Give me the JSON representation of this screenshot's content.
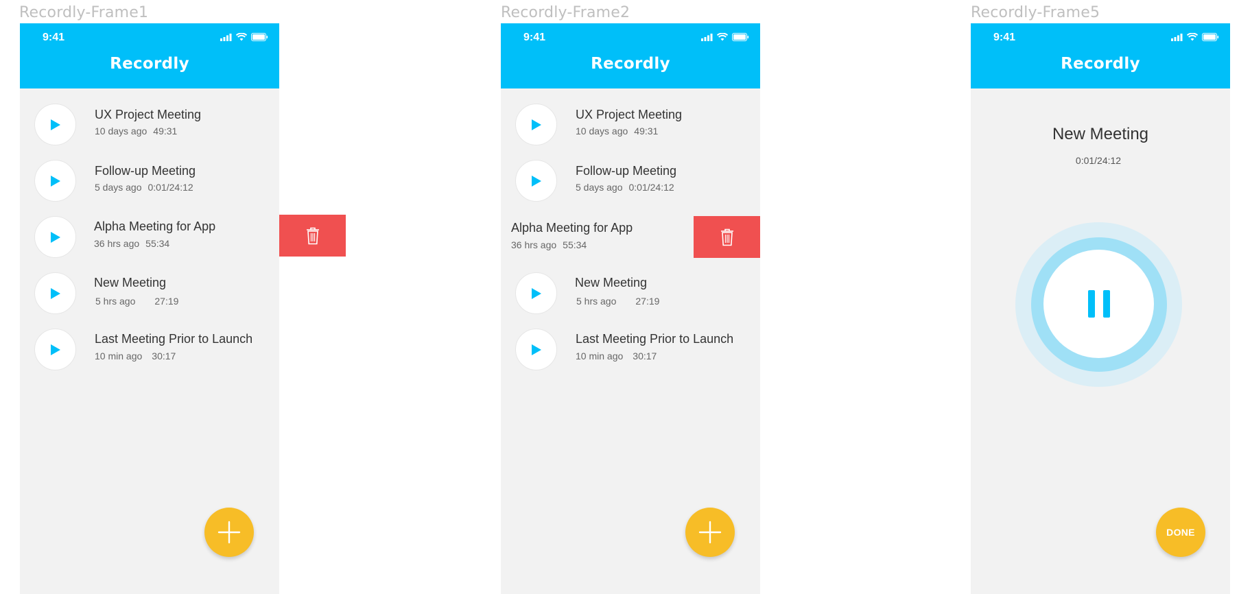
{
  "frames": [
    {
      "label": "Recordly-Frame1",
      "status_time": "9:41",
      "app_title": "Recordly",
      "recordings": [
        {
          "title": "UX Project Meeting",
          "age": "10 days ago",
          "duration": "49:31"
        },
        {
          "title": "Follow-up Meeting",
          "age": "5 days ago",
          "duration": "0:01/24:12"
        },
        {
          "title": "Alpha Meeting for App",
          "age": "36 hrs ago",
          "duration": "55:34"
        },
        {
          "title": "New Meeting",
          "age": "5 hrs ago",
          "duration": "27:19"
        },
        {
          "title": "Last Meeting Prior to Launch",
          "age": "10 min ago",
          "duration": "30:17"
        }
      ],
      "fab_icon": "plus-icon"
    },
    {
      "label": "Recordly-Frame2",
      "status_time": "9:41",
      "app_title": "Recordly",
      "recordings": [
        {
          "title": "UX Project Meeting",
          "age": "10 days ago",
          "duration": "49:31"
        },
        {
          "title": "Follow-up Meeting",
          "age": "5 days ago",
          "duration": "0:01/24:12"
        },
        {
          "title": "Alpha Meeting for App",
          "age": "36 hrs ago",
          "duration": "55:34"
        },
        {
          "title": "New Meeting",
          "age": "5 hrs ago",
          "duration": "27:19"
        },
        {
          "title": "Last Meeting Prior to Launch",
          "age": "10 min ago",
          "duration": "30:17"
        }
      ],
      "fab_icon": "plus-icon"
    },
    {
      "label": "Recordly-Frame5",
      "status_time": "9:41",
      "app_title": "Recordly",
      "recording_title": "New Meeting",
      "recording_time": "0:01/24:12",
      "control_icon": "pause-icon",
      "done_label": "DONE"
    }
  ],
  "colors": {
    "header": "#00bff9",
    "background": "#f2f2f2",
    "accent": "#00bff9",
    "delete": "#f05050",
    "fab": "#f7bd27"
  }
}
